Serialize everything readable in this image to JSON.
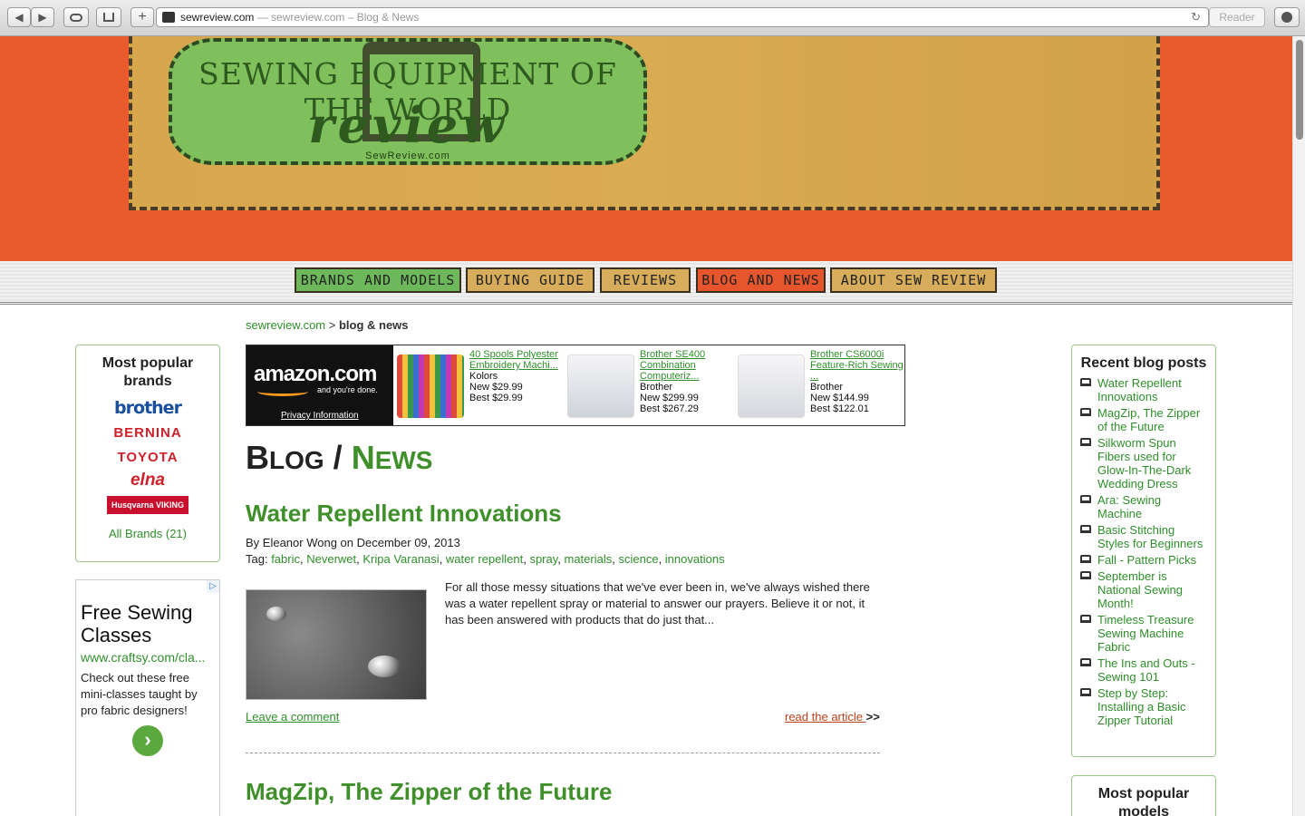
{
  "browser": {
    "url_domain": "sewreview.com",
    "url_rest": " — sewreview.com – Blog & News",
    "reader_label": "Reader",
    "back_glyph": "◀",
    "forward_glyph": "▶",
    "add_glyph": "+",
    "reload_glyph": "↻"
  },
  "header": {
    "patch_top": "SEWING EQUIPMENT OF THE WORLD",
    "patch_main": "review",
    "patch_site": "SewReview.com"
  },
  "nav": [
    {
      "label": "BRANDS AND MODELS"
    },
    {
      "label": "BUYING GUIDE"
    },
    {
      "label": "REVIEWS"
    },
    {
      "label": "BLOG AND NEWS"
    },
    {
      "label": "ABOUT  SEW REVIEW"
    }
  ],
  "breadcrumb": {
    "home": "sewreview.com",
    "sep": " > ",
    "current": "blog & news"
  },
  "left": {
    "brands_title": "Most popular brands",
    "brands": [
      "brother",
      "BERNINA",
      "TOYOTA",
      "elna",
      "Husqvarna VIKING"
    ],
    "all_brands": "All Brands (21)"
  },
  "ad": {
    "title": "Free Sewing Classes",
    "url": "www.craftsy.com/cla...",
    "text": "Check out these free mini-classes taught by pro fabric designers!",
    "choice": "▷",
    "go": "›"
  },
  "amazon": {
    "logo": "amazon.com",
    "tagline": "and you're done.",
    "privacy": "Privacy Information",
    "items": [
      {
        "title": "40 Spools Polyester Embroidery Machi...",
        "brand": "Kolors",
        "new": "New $29.99",
        "best": "Best $29.99"
      },
      {
        "title": "Brother SE400 Combination Computeriz...",
        "brand": "Brother",
        "new": "New $299.99",
        "best": "Best $267.29"
      },
      {
        "title": "Brother CS6000i Feature-Rich Sewing ...",
        "brand": "Brother",
        "new": "New $144.99",
        "best": "Best $122.01"
      }
    ]
  },
  "page": {
    "title_a": "B",
    "title_b": "LOG",
    "title_sep": " / ",
    "title_c": "N",
    "title_d": "EWS"
  },
  "posts": [
    {
      "title": "Water Repellent Innovations",
      "byline": "By Eleanor Wong on December 09, 2013",
      "tag_label": "Tag: ",
      "tags": [
        "fabric",
        "Neverwet",
        "Kripa Varanasi",
        "water repellent",
        "spray",
        "materials",
        "science",
        "innovations"
      ],
      "excerpt": "For all those messy situations that we've ever been in, we've always wished there was a water repellent spray or material to answer our prayers. Believe it or not, it has been answered with products that do just that...",
      "comment": "Leave a comment",
      "read": "read the article ",
      "read_suffix": ">>"
    },
    {
      "title": "MagZip, The Zipper of the Future"
    }
  ],
  "right": {
    "recent_title": "Recent blog posts",
    "recent": [
      "Water Repellent Innovations",
      "MagZip, The Zipper of the Future",
      "Silkworm Spun Fibers used for Glow-In-The-Dark Wedding Dress",
      "Ara: Sewing Machine",
      "Basic Stitching Styles for Beginners",
      "Fall - Pattern Picks",
      "September is National Sewing Month!",
      "Timeless Treasure Sewing Machine Fabric",
      "The Ins and Outs - Sewing 101",
      "Step by Step: Installing a Basic Zipper Tutorial"
    ],
    "models_title": "Most popular models"
  }
}
